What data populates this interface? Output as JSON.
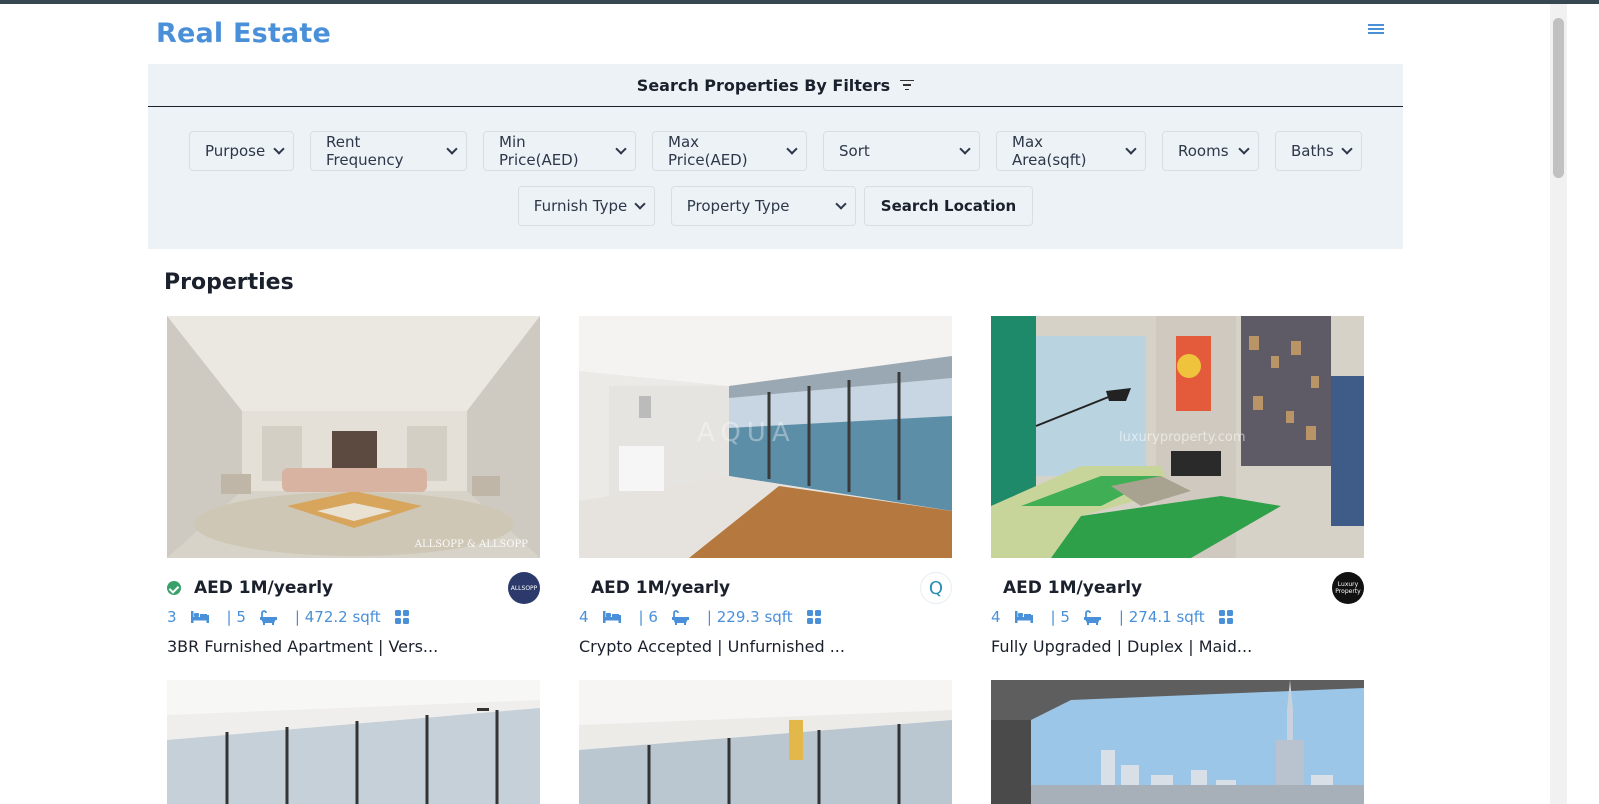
{
  "brand": "Real Estate",
  "filters": {
    "title": "Search Properties By Filters",
    "row1": [
      "Purpose",
      "Rent Frequency",
      "Min Price(AED)",
      "Max Price(AED)",
      "Sort",
      "Max Area(sqft)",
      "Rooms",
      "Baths"
    ],
    "row2": [
      "Furnish Type",
      "Property Type"
    ],
    "search_location": "Search Location"
  },
  "section_title": "Properties",
  "properties": [
    {
      "price": "AED 1M/yearly",
      "verified": true,
      "rooms": "3",
      "baths": "| 5",
      "area": "| 472.2 sqft",
      "title": "3BR Furnished Apartment | Vers...",
      "agency": "ALLSOPP"
    },
    {
      "price": "AED 1M/yearly",
      "verified": false,
      "rooms": "4",
      "baths": "| 6",
      "area": "| 229.3 sqft",
      "title": "Crypto Accepted | Unfurnished ...",
      "agency": "Q"
    },
    {
      "price": "AED 1M/yearly",
      "verified": false,
      "rooms": "4",
      "baths": "| 5",
      "area": "| 274.1 sqft",
      "title": "Fully Upgraded | Duplex | Maid...",
      "agency": "Luxury Property"
    }
  ],
  "image_watermarks": [
    "ALLSOPP & ALLSOPP",
    "AQUA",
    "luxuryproperty.com"
  ],
  "colors": {
    "brand": "#4a90d9",
    "panel": "#edf2f7",
    "verified": "#38a169"
  }
}
